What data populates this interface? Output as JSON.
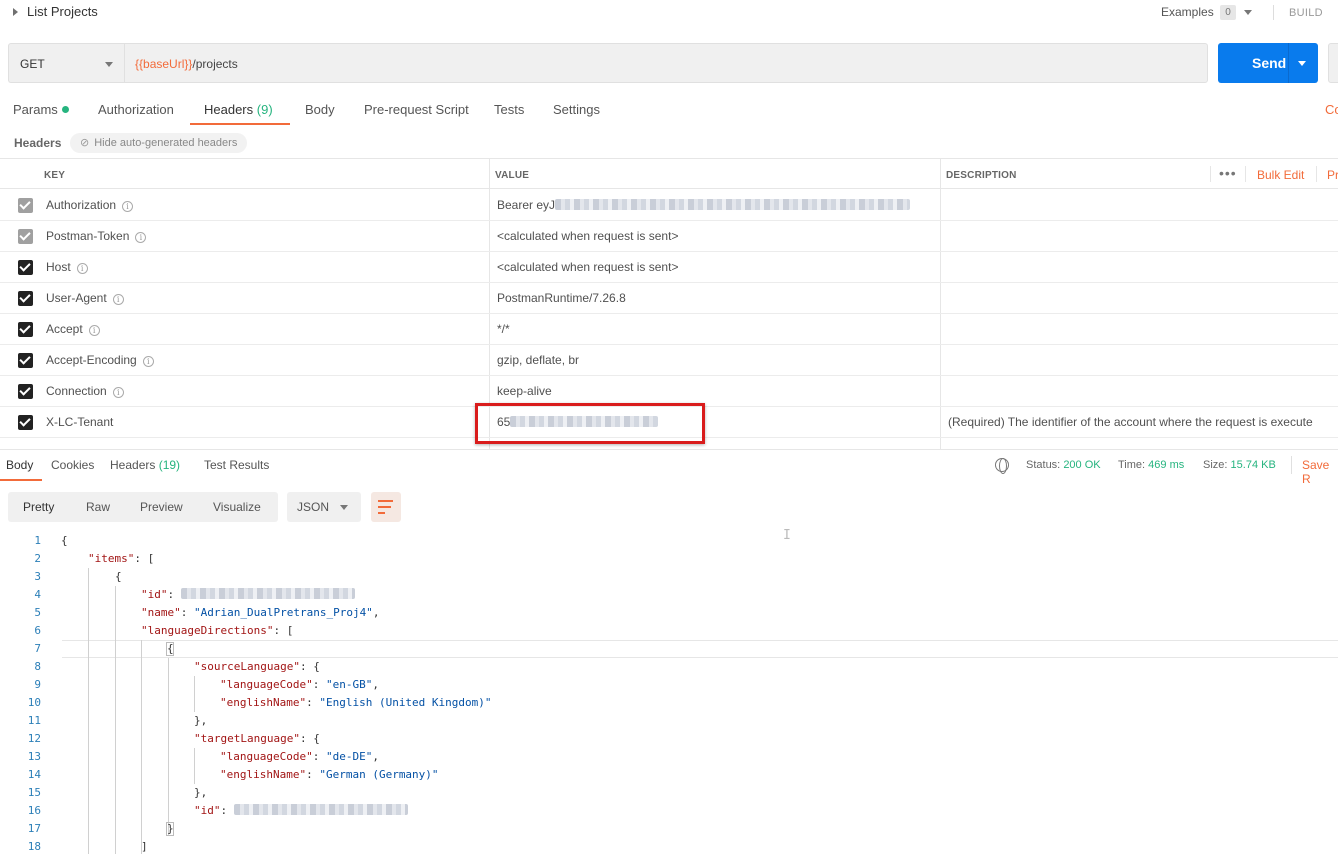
{
  "top": {
    "title": "List Projects",
    "examples_label": "Examples",
    "examples_count": "0",
    "build_label": "BUILD"
  },
  "request": {
    "method": "GET",
    "url_var": "{{baseUrl}}",
    "url_path": "/projects",
    "send_label": "Send"
  },
  "tabs": [
    {
      "label": "Params"
    },
    {
      "label": "Authorization"
    },
    {
      "label": "Headers",
      "count": "(9)"
    },
    {
      "label": "Body"
    },
    {
      "label": "Pre-request Script"
    },
    {
      "label": "Tests"
    },
    {
      "label": "Settings"
    }
  ],
  "code_link": "Co",
  "headers_section": {
    "label": "Headers",
    "hide_auto": "Hide auto-generated headers"
  },
  "table": {
    "columns": [
      "KEY",
      "VALUE",
      "DESCRIPTION"
    ],
    "bulk_edit": "Bulk Edit",
    "presets": "Pr",
    "rows": [
      {
        "key": "Authorization",
        "value": "Bearer eyJ",
        "desc": ""
      },
      {
        "key": "Postman-Token",
        "value": "<calculated when request is sent>",
        "desc": ""
      },
      {
        "key": "Host",
        "value": "<calculated when request is sent>",
        "desc": ""
      },
      {
        "key": "User-Agent",
        "value": "PostmanRuntime/7.26.8",
        "desc": ""
      },
      {
        "key": "Accept",
        "value": "*/*",
        "desc": ""
      },
      {
        "key": "Accept-Encoding",
        "value": "gzip, deflate, br",
        "desc": ""
      },
      {
        "key": "Connection",
        "value": "keep-alive",
        "desc": ""
      },
      {
        "key": "X-LC-Tenant",
        "value": "65",
        "desc": "(Required) The identifier of the account where the request is execute"
      }
    ]
  },
  "response": {
    "tabs": [
      {
        "label": "Body"
      },
      {
        "label": "Cookies"
      },
      {
        "label": "Headers",
        "count": "(19)"
      },
      {
        "label": "Test Results"
      }
    ],
    "status_label": "Status:",
    "status_value": "200 OK",
    "time_label": "Time:",
    "time_value": "469 ms",
    "size_label": "Size:",
    "size_value": "15.74 KB",
    "save_label": "Save R",
    "modes": [
      "Pretty",
      "Raw",
      "Preview",
      "Visualize"
    ],
    "format": "JSON"
  },
  "code": {
    "line_numbers": [
      "1",
      "2",
      "3",
      "4",
      "5",
      "6",
      "7",
      "8",
      "9",
      "10",
      "11",
      "12",
      "13",
      "14",
      "15",
      "16",
      "17",
      "18"
    ],
    "items_key": "\"items\"",
    "id_key": "\"id\"",
    "name_key": "\"name\"",
    "name_value": "\"Adrian_DualPretrans_Proj4\"",
    "langdir_key": "\"languageDirections\"",
    "source_key": "\"sourceLanguage\"",
    "target_key": "\"targetLanguage\"",
    "code_key": "\"languageCode\"",
    "english_key": "\"englishName\"",
    "src_code": "\"en-GB\"",
    "src_name": "\"English (United Kingdom)\"",
    "tgt_code": "\"de-DE\"",
    "tgt_name": "\"German (Germany)\""
  }
}
